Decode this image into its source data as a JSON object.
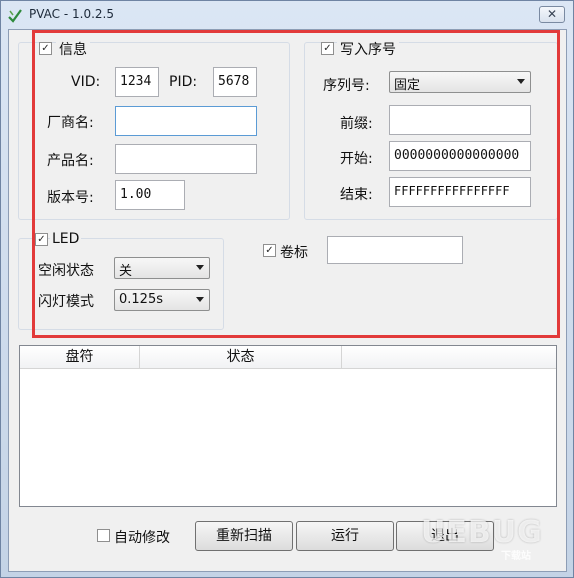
{
  "window": {
    "title": "PVAC - 1.0.2.5",
    "close": "✕"
  },
  "info_group": {
    "checkbox_label": "信息",
    "vid_label": "VID:",
    "vid_value": "1234",
    "pid_label": "PID:",
    "pid_value": "5678",
    "vendor_label": "厂商名:",
    "vendor_value": "",
    "product_label": "产品名:",
    "product_value": "",
    "version_label": "版本号:",
    "version_value": "1.00"
  },
  "serial_group": {
    "checkbox_label": "写入序号",
    "type_label": "序列号:",
    "type_value": "固定",
    "prefix_label": "前缀:",
    "prefix_value": "",
    "start_label": "开始:",
    "start_value": "0000000000000000",
    "end_label": "结束:",
    "end_value": "FFFFFFFFFFFFFFFF"
  },
  "led_group": {
    "checkbox_label": "LED",
    "idle_label": "空闲状态",
    "idle_value": "关",
    "blink_label": "闪灯模式",
    "blink_value": "0.125s"
  },
  "volume": {
    "checkbox_label": "卷标",
    "value": ""
  },
  "table": {
    "columns": [
      "盘符",
      "状态"
    ]
  },
  "footer": {
    "auto_modify_label": "自动修改",
    "rescan_label": "重新扫描",
    "run_label": "运行",
    "exit_label": "退出"
  },
  "watermark": {
    "text": "UEBUG",
    "sub": "下载站"
  },
  "colors": {
    "highlight_box": "#e23a3a",
    "client_bg": "#f0f0f0",
    "title_bg": "#c9d6e6"
  }
}
